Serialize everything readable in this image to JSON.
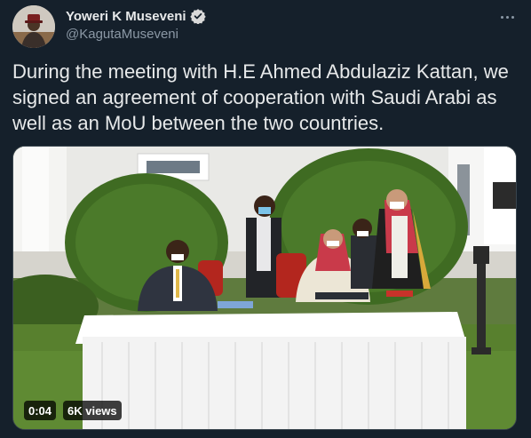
{
  "tweet": {
    "display_name": "Yoweri K Museveni",
    "handle": "@KagutaMuseveni",
    "text": "During the meeting with H.E Ahmed Abdulaziz Kattan, we signed an agreement of cooperation with Saudi Arabi as well as an MoU between the two countries.",
    "verified": true
  },
  "media": {
    "duration": "0:04",
    "views": "6K views"
  },
  "icons": {
    "verified": "verified-badge-icon",
    "more": "more-options-icon"
  },
  "colors": {
    "background": "#15202b",
    "text": "#e7e9ea",
    "secondary_text": "#8b98a5",
    "verified": "#1d9bf0"
  }
}
